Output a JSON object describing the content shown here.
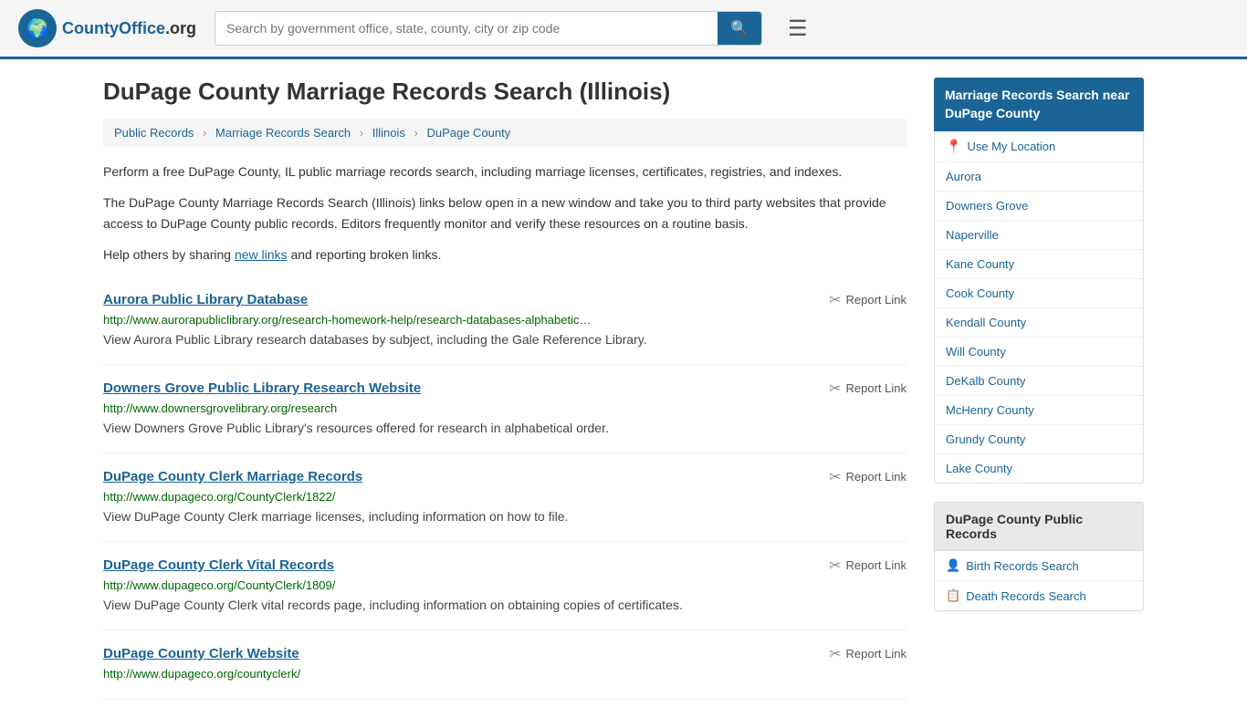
{
  "header": {
    "logo_symbol": "🌍",
    "logo_brand": "CountyOffice",
    "logo_tld": ".org",
    "search_placeholder": "Search by government office, state, county, city or zip code",
    "search_button_icon": "🔍"
  },
  "page": {
    "title": "DuPage County Marriage Records Search (Illinois)",
    "breadcrumb": [
      {
        "label": "Public Records",
        "href": "#"
      },
      {
        "label": "Marriage Records Search",
        "href": "#"
      },
      {
        "label": "Illinois",
        "href": "#"
      },
      {
        "label": "DuPage County",
        "href": "#"
      }
    ],
    "description1": "Perform a free DuPage County, IL public marriage records search, including marriage licenses, certificates, registries, and indexes.",
    "description2": "The DuPage County Marriage Records Search (Illinois) links below open in a new window and take you to third party websites that provide access to DuPage County public records. Editors frequently monitor and verify these resources on a routine basis.",
    "description3_prefix": "Help others by sharing ",
    "description3_link": "new links",
    "description3_suffix": " and reporting broken links."
  },
  "results": [
    {
      "title": "Aurora Public Library Database",
      "url": "http://www.aurorapubliclibrary.org/research-homework-help/research-databases-alphabetic…",
      "description": "View Aurora Public Library research databases by subject, including the Gale Reference Library.",
      "report_label": "Report Link"
    },
    {
      "title": "Downers Grove Public Library Research Website",
      "url": "http://www.downersgrovelibrary.org/research",
      "description": "View Downers Grove Public Library's resources offered for research in alphabetical order.",
      "report_label": "Report Link"
    },
    {
      "title": "DuPage County Clerk Marriage Records",
      "url": "http://www.dupageco.org/CountyClerk/1822/",
      "description": "View DuPage County Clerk marriage licenses, including information on how to file.",
      "report_label": "Report Link"
    },
    {
      "title": "DuPage County Clerk Vital Records",
      "url": "http://www.dupageco.org/CountyClerk/1809/",
      "description": "View DuPage County Clerk vital records page, including information on obtaining copies of certificates.",
      "report_label": "Report Link"
    },
    {
      "title": "DuPage County Clerk Website",
      "url": "http://www.dupageco.org/countyclerk/",
      "description": "",
      "report_label": "Report Link"
    }
  ],
  "sidebar": {
    "nearby_heading": "Marriage Records Search near DuPage County",
    "use_my_location": "Use My Location",
    "nearby_links": [
      {
        "label": "Aurora"
      },
      {
        "label": "Downers Grove"
      },
      {
        "label": "Naperville"
      },
      {
        "label": "Kane County"
      },
      {
        "label": "Cook County"
      },
      {
        "label": "Kendall County"
      },
      {
        "label": "Will County"
      },
      {
        "label": "DeKalb County"
      },
      {
        "label": "McHenry County"
      },
      {
        "label": "Grundy County"
      },
      {
        "label": "Lake County"
      }
    ],
    "public_records_heading": "DuPage County Public Records",
    "public_records_links": [
      {
        "label": "Birth Records Search",
        "icon": "👤"
      },
      {
        "label": "Death Records Search",
        "icon": "📋"
      }
    ]
  }
}
